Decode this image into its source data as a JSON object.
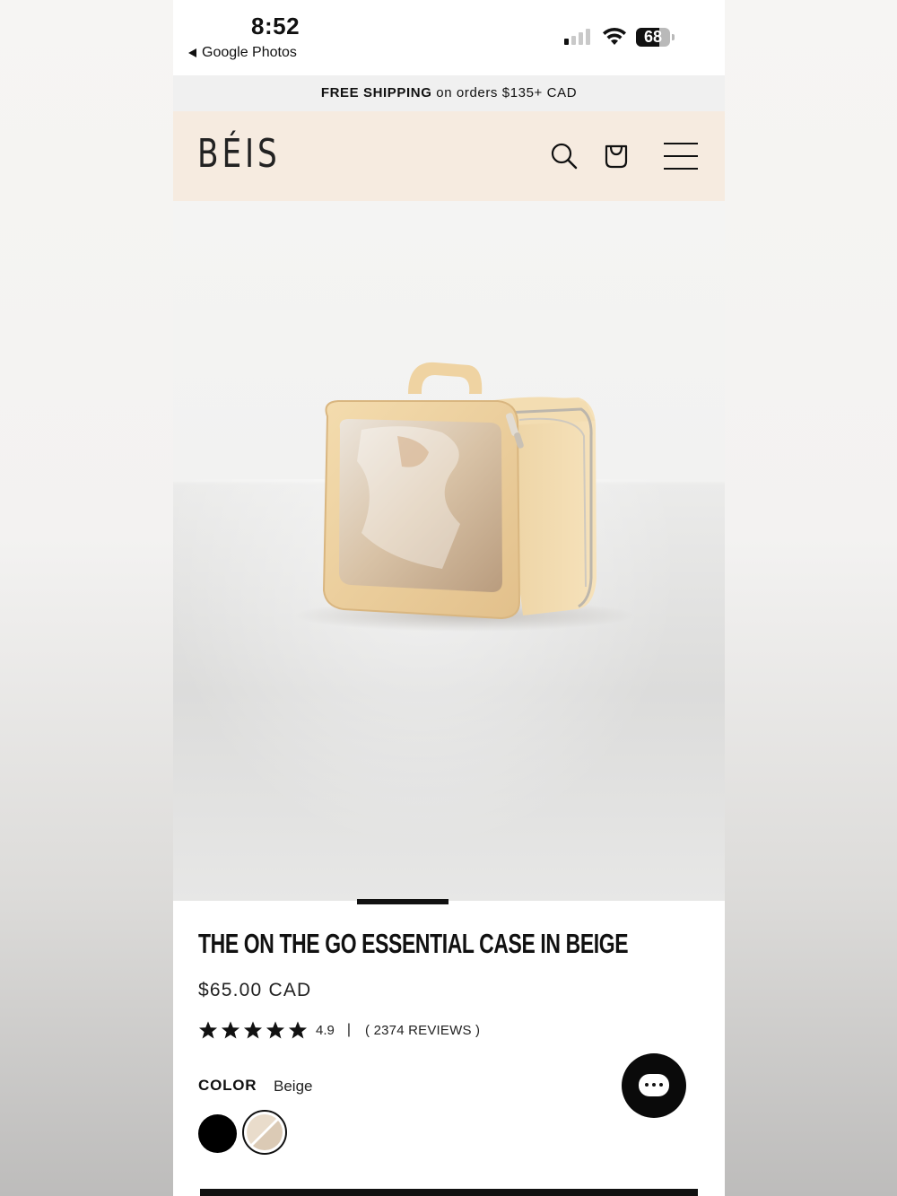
{
  "status_bar": {
    "time": "8:52",
    "back_label": "Google Photos",
    "battery_level": "68"
  },
  "announcement": {
    "bold": "FREE SHIPPING",
    "rest": " on orders $135+ CAD"
  },
  "header": {
    "logo": "BÉIS",
    "icons": [
      "search-icon",
      "cart-icon",
      "menu-icon"
    ]
  },
  "hero": {
    "carousel_index": 2,
    "carousel_count": 6
  },
  "product": {
    "title": "THE ON THE GO ESSENTIAL CASE IN BEIGE",
    "price": "$65.00 CAD",
    "rating": 4.9,
    "rating_text": "4.9",
    "separator": "|",
    "reviews": "( 2374 REVIEWS )",
    "color_label": "COLOR",
    "color_value": "Beige",
    "swatches": [
      "Black",
      "Beige"
    ]
  },
  "colors": {
    "header_bg": "#f6ebe0",
    "announcement_bg": "#f0f0f0",
    "accent": "#111111"
  }
}
